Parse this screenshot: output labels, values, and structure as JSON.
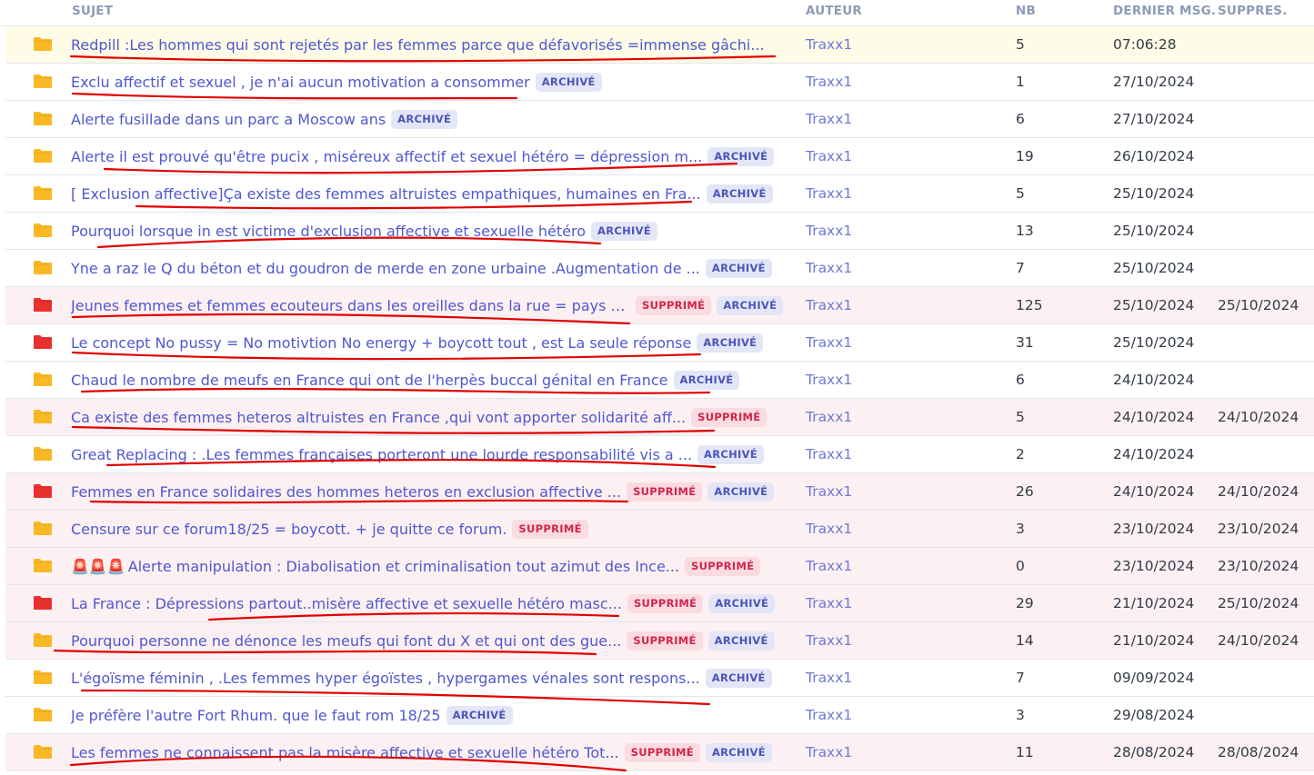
{
  "headers": {
    "subject": "SUJET",
    "author": "AUTEUR",
    "count": "NB",
    "last_msg": "DERNIER MSG.",
    "deleted": "SUPPRES."
  },
  "colors": {
    "folder_yellow": "#f8b924",
    "folder_red": "#e8302e",
    "link": "#4f58cf",
    "highlight_row": "#fefbe6",
    "deleted_row": "#fdf0f2",
    "archived_badge_bg": "#e3e6f7",
    "deleted_badge_bg": "#fadbe1",
    "annotation_ink": "#e00000"
  },
  "badge_labels": {
    "archived": "ARCHIVÉ",
    "deleted": "SUPPRIMÉ"
  },
  "topics": [
    {
      "folder": "yellow",
      "emoji": "",
      "subject": "Redpill :Les hommes qui sont rejetés par les femmes parce que défavorisés =immense gâchi...",
      "deleted_badge": false,
      "archived_badge": false,
      "author": "Traxx1",
      "count": "5",
      "last_msg": "07:06:28",
      "deleted_date": "",
      "row_state": "highlight"
    },
    {
      "folder": "yellow",
      "emoji": "",
      "subject": "Exclu affectif et sexuel , je n'ai aucun motivation a consommer",
      "deleted_badge": false,
      "archived_badge": true,
      "author": "Traxx1",
      "count": "1",
      "last_msg": "27/10/2024",
      "deleted_date": "",
      "row_state": "normal"
    },
    {
      "folder": "yellow",
      "emoji": "",
      "subject": "Alerte fusillade dans un parc a Moscow ans",
      "deleted_badge": false,
      "archived_badge": true,
      "author": "Traxx1",
      "count": "6",
      "last_msg": "27/10/2024",
      "deleted_date": "",
      "row_state": "normal"
    },
    {
      "folder": "yellow",
      "emoji": "",
      "subject": "Alerte il est prouvé qu'être pucix , miséreux affectif et sexuel hétéro = dépression m...",
      "deleted_badge": false,
      "archived_badge": true,
      "author": "Traxx1",
      "count": "19",
      "last_msg": "26/10/2024",
      "deleted_date": "",
      "row_state": "normal"
    },
    {
      "folder": "yellow",
      "emoji": "",
      "subject": "[ Exclusion affective]Ça existe des femmes altruistes empathiques, humaines en Fra...",
      "deleted_badge": false,
      "archived_badge": true,
      "author": "Traxx1",
      "count": "5",
      "last_msg": "25/10/2024",
      "deleted_date": "",
      "row_state": "normal"
    },
    {
      "folder": "yellow",
      "emoji": "",
      "subject": "Pourquoi lorsque in est victime d'exclusion affective et sexuelle hétéro",
      "deleted_badge": false,
      "archived_badge": true,
      "author": "Traxx1",
      "count": "13",
      "last_msg": "25/10/2024",
      "deleted_date": "",
      "row_state": "normal"
    },
    {
      "folder": "yellow",
      "emoji": "",
      "subject": "Yne a raz le Q du béton et du goudron de merde en zone urbaine .Augmentation de ...",
      "deleted_badge": false,
      "archived_badge": true,
      "author": "Traxx1",
      "count": "7",
      "last_msg": "25/10/2024",
      "deleted_date": "",
      "row_state": "normal"
    },
    {
      "folder": "red",
      "emoji": "",
      "subject": "Jeunes femmes et femmes ecouteurs dans les oreilles dans la rue = pays d...",
      "deleted_badge": true,
      "archived_badge": true,
      "author": "Traxx1",
      "count": "125",
      "last_msg": "25/10/2024",
      "deleted_date": "25/10/2024",
      "row_state": "deleted"
    },
    {
      "folder": "red",
      "emoji": "",
      "subject": "Le concept No pussy = No motivtion No energy + boycott tout , est La seule réponse",
      "deleted_badge": false,
      "archived_badge": true,
      "author": "Traxx1",
      "count": "31",
      "last_msg": "25/10/2024",
      "deleted_date": "",
      "row_state": "normal"
    },
    {
      "folder": "yellow",
      "emoji": "",
      "subject": "Chaud le nombre de meufs en France qui ont de l'herpès buccal génital en France",
      "deleted_badge": false,
      "archived_badge": true,
      "author": "Traxx1",
      "count": "6",
      "last_msg": "24/10/2024",
      "deleted_date": "",
      "row_state": "normal"
    },
    {
      "folder": "yellow",
      "emoji": "",
      "subject": "Ca existe des femmes heteros altruistes en France ,qui vont apporter solidarité aff...",
      "deleted_badge": true,
      "archived_badge": false,
      "author": "Traxx1",
      "count": "5",
      "last_msg": "24/10/2024",
      "deleted_date": "24/10/2024",
      "row_state": "deleted"
    },
    {
      "folder": "yellow",
      "emoji": "",
      "subject": "Great Replacing : .Les femmes françaises porteront une lourde responsabilité vis a ...",
      "deleted_badge": false,
      "archived_badge": true,
      "author": "Traxx1",
      "count": "2",
      "last_msg": "24/10/2024",
      "deleted_date": "",
      "row_state": "normal"
    },
    {
      "folder": "red",
      "emoji": "",
      "subject": "Femmes en France solidaires des hommes heteros en exclusion affective ...",
      "deleted_badge": true,
      "archived_badge": true,
      "author": "Traxx1",
      "count": "26",
      "last_msg": "24/10/2024",
      "deleted_date": "24/10/2024",
      "row_state": "deleted"
    },
    {
      "folder": "yellow",
      "emoji": "",
      "subject": "Censure sur ce forum18/25 = boycott. + je quitte ce forum.",
      "deleted_badge": true,
      "archived_badge": false,
      "author": "Traxx1",
      "count": "3",
      "last_msg": "23/10/2024",
      "deleted_date": "23/10/2024",
      "row_state": "deleted"
    },
    {
      "folder": "yellow",
      "emoji": "🚨🚨🚨",
      "subject": "Alerte manipulation : Diabolisation et criminalisation tout azimut des Ince...",
      "deleted_badge": true,
      "archived_badge": false,
      "author": "Traxx1",
      "count": "0",
      "last_msg": "23/10/2024",
      "deleted_date": "23/10/2024",
      "row_state": "deleted"
    },
    {
      "folder": "red",
      "emoji": "",
      "subject": "La France : Dépressions partout..misère affective et sexuelle hétéro masc...",
      "deleted_badge": true,
      "archived_badge": true,
      "author": "Traxx1",
      "count": "29",
      "last_msg": "21/10/2024",
      "deleted_date": "25/10/2024",
      "row_state": "deleted"
    },
    {
      "folder": "yellow",
      "emoji": "",
      "subject": "Pourquoi personne ne dénonce les meufs qui font du X et qui ont des gue...",
      "deleted_badge": true,
      "archived_badge": true,
      "author": "Traxx1",
      "count": "14",
      "last_msg": "21/10/2024",
      "deleted_date": "24/10/2024",
      "row_state": "deleted"
    },
    {
      "folder": "yellow",
      "emoji": "",
      "subject": "L'égoïsme féminin , .Les femmes hyper égoïstes , hypergames vénales sont respons...",
      "deleted_badge": false,
      "archived_badge": true,
      "author": "Traxx1",
      "count": "7",
      "last_msg": "09/09/2024",
      "deleted_date": "",
      "row_state": "normal"
    },
    {
      "folder": "yellow",
      "emoji": "",
      "subject": "Je préfère l'autre Fort Rhum. que le faut rom 18/25",
      "deleted_badge": false,
      "archived_badge": true,
      "author": "Traxx1",
      "count": "3",
      "last_msg": "29/08/2024",
      "deleted_date": "",
      "row_state": "normal"
    },
    {
      "folder": "yellow",
      "emoji": "",
      "subject": "Les femmes ne connaissent pas la misère affective et sexuelle hétéro Tot...",
      "deleted_badge": true,
      "archived_badge": true,
      "author": "Traxx1",
      "count": "11",
      "last_msg": "28/08/2024",
      "deleted_date": "28/08/2024",
      "row_state": "deleted"
    }
  ]
}
